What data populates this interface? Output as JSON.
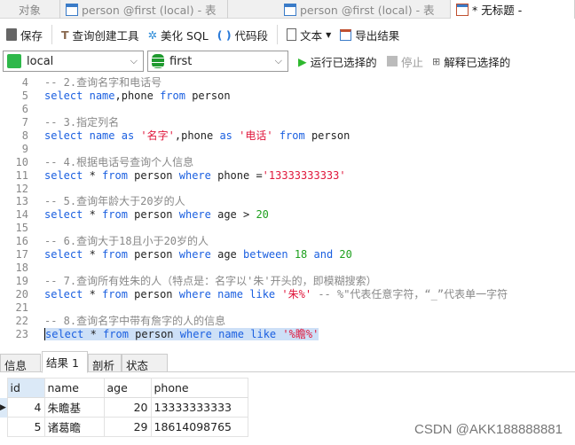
{
  "tabs": [
    {
      "label": "对象"
    },
    {
      "label": "person @first (local) - 表"
    },
    {
      "label": "person @first (local) - 表"
    },
    {
      "label": "* 无标题 -"
    }
  ],
  "toolbar": {
    "save": "保存",
    "query_builder": "查询创建工具",
    "beautify": "美化 SQL",
    "snippet": "代码段",
    "text": "文本",
    "export": "导出结果"
  },
  "connection": {
    "value": "local",
    "database": "first",
    "run": "运行已选择的",
    "stop": "停止",
    "explain": "解释已选择的"
  },
  "editor": {
    "lines": [
      {
        "n": "4",
        "t": [
          [
            "cm",
            "-- 2.查询名字和电话号"
          ]
        ]
      },
      {
        "n": "5",
        "t": [
          [
            "kw",
            "select"
          ],
          [
            "tx",
            " "
          ],
          [
            "kw",
            "name"
          ],
          [
            "tx",
            ",phone "
          ],
          [
            "kw",
            "from"
          ],
          [
            "tx",
            " person"
          ]
        ]
      },
      {
        "n": "6",
        "t": []
      },
      {
        "n": "7",
        "t": [
          [
            "cm",
            "-- 3.指定列名"
          ]
        ]
      },
      {
        "n": "8",
        "t": [
          [
            "kw",
            "select"
          ],
          [
            "tx",
            " "
          ],
          [
            "kw",
            "name"
          ],
          [
            "tx",
            " "
          ],
          [
            "kw",
            "as"
          ],
          [
            "tx",
            " "
          ],
          [
            "st",
            "'名字'"
          ],
          [
            "tx",
            ",phone "
          ],
          [
            "kw",
            "as"
          ],
          [
            "tx",
            " "
          ],
          [
            "st",
            "'电话'"
          ],
          [
            "tx",
            " "
          ],
          [
            "kw",
            "from"
          ],
          [
            "tx",
            " person"
          ]
        ]
      },
      {
        "n": "9",
        "t": []
      },
      {
        "n": "10",
        "t": [
          [
            "cm",
            "-- 4.根据电话号查询个人信息"
          ]
        ]
      },
      {
        "n": "11",
        "t": [
          [
            "kw",
            "select"
          ],
          [
            "tx",
            " * "
          ],
          [
            "kw",
            "from"
          ],
          [
            "tx",
            " person "
          ],
          [
            "kw",
            "where"
          ],
          [
            "tx",
            " phone ="
          ],
          [
            "st",
            "'13333333333'"
          ]
        ]
      },
      {
        "n": "12",
        "t": []
      },
      {
        "n": "13",
        "t": [
          [
            "cm",
            "-- 5.查询年龄大于20岁的人"
          ]
        ]
      },
      {
        "n": "14",
        "t": [
          [
            "kw",
            "select"
          ],
          [
            "tx",
            " * "
          ],
          [
            "kw",
            "from"
          ],
          [
            "tx",
            " person "
          ],
          [
            "kw",
            "where"
          ],
          [
            "tx",
            " age > "
          ],
          [
            "num",
            "20"
          ]
        ]
      },
      {
        "n": "15",
        "t": []
      },
      {
        "n": "16",
        "t": [
          [
            "cm",
            "-- 6.查询大于18且小于20岁的人"
          ]
        ]
      },
      {
        "n": "17",
        "t": [
          [
            "kw",
            "select"
          ],
          [
            "tx",
            " * "
          ],
          [
            "kw",
            "from"
          ],
          [
            "tx",
            " person "
          ],
          [
            "kw",
            "where"
          ],
          [
            "tx",
            " age "
          ],
          [
            "kw",
            "between"
          ],
          [
            "tx",
            " "
          ],
          [
            "num",
            "18"
          ],
          [
            "tx",
            " "
          ],
          [
            "kw",
            "and"
          ],
          [
            "tx",
            " "
          ],
          [
            "num",
            "20"
          ]
        ]
      },
      {
        "n": "18",
        "t": []
      },
      {
        "n": "19",
        "t": [
          [
            "cm",
            "-- 7.查询所有姓朱的人（特点是：名字以'朱'开头的，即模糊搜索）"
          ]
        ]
      },
      {
        "n": "20",
        "t": [
          [
            "kw",
            "select"
          ],
          [
            "tx",
            " * "
          ],
          [
            "kw",
            "from"
          ],
          [
            "tx",
            " person "
          ],
          [
            "kw",
            "where"
          ],
          [
            "tx",
            " "
          ],
          [
            "kw",
            "name"
          ],
          [
            "tx",
            " "
          ],
          [
            "kw",
            "like"
          ],
          [
            "tx",
            " "
          ],
          [
            "st",
            "'朱%'"
          ],
          [
            "tx",
            " "
          ],
          [
            "cm",
            "-- %\"代表任意字符，“_”代表单一字符"
          ]
        ]
      },
      {
        "n": "21",
        "t": []
      },
      {
        "n": "22",
        "t": [
          [
            "cm",
            "-- 8.查询名字中带有詹字的人的信息"
          ]
        ]
      },
      {
        "n": "23",
        "sel": true,
        "t": [
          [
            "kw",
            "select"
          ],
          [
            "tx",
            " * "
          ],
          [
            "kw",
            "from"
          ],
          [
            "tx",
            " person "
          ],
          [
            "kw",
            "where"
          ],
          [
            "tx",
            " "
          ],
          [
            "kw",
            "name"
          ],
          [
            "tx",
            " "
          ],
          [
            "kw",
            "like"
          ],
          [
            "tx",
            " "
          ],
          [
            "st",
            "'%瞻%'"
          ]
        ]
      }
    ]
  },
  "result_tabs": [
    {
      "label": "信息"
    },
    {
      "label": "结果 1"
    },
    {
      "label": "剖析"
    },
    {
      "label": "状态"
    }
  ],
  "grid": {
    "columns": [
      "id",
      "name",
      "age",
      "phone"
    ],
    "rows": [
      [
        "4",
        "朱瞻基",
        "20",
        "13333333333"
      ],
      [
        "5",
        "诸葛瞻",
        "29",
        "18614098765"
      ]
    ]
  },
  "watermark": "CSDN @AKK188888881",
  "colors": {
    "keyword": "#1a5fe0",
    "string": "#e0173c",
    "comment": "#888888",
    "number": "#1ea01e",
    "selection": "#cde0f7"
  }
}
